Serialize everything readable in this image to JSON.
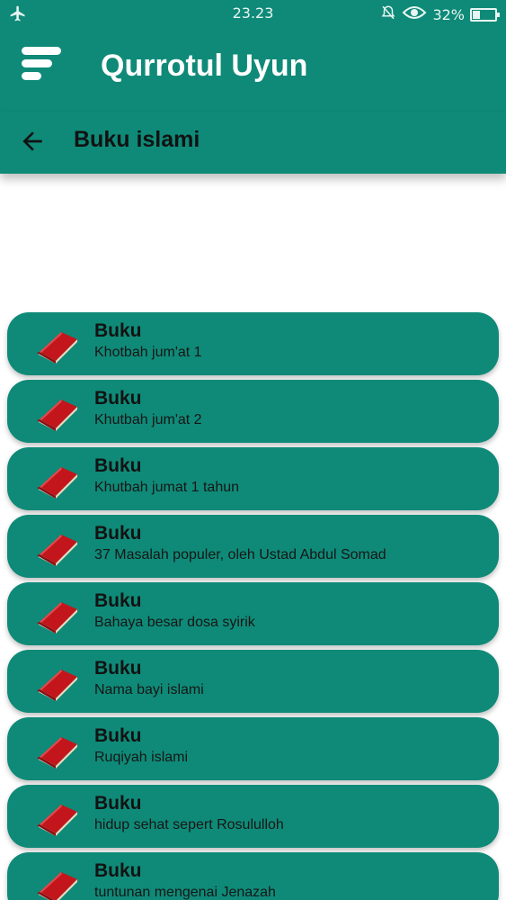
{
  "status_bar": {
    "time": "23.23",
    "battery_text": "32%",
    "battery_level": 0.32,
    "icons": [
      "airplane-icon",
      "alarm-off-icon",
      "eye-icon",
      "battery-icon"
    ]
  },
  "app_bar": {
    "title": "Qurrotul Uyun",
    "menu_icon": "menu-icon"
  },
  "sub_bar": {
    "title": "Buku islami",
    "back_icon": "back-arrow-icon"
  },
  "items": [
    {
      "title": "Buku",
      "subtitle": "Khotbah jum'at 1"
    },
    {
      "title": "Buku",
      "subtitle": "Khutbah jum'at 2"
    },
    {
      "title": "Buku",
      "subtitle": "Khutbah jumat 1 tahun"
    },
    {
      "title": "Buku",
      "subtitle": "37 Masalah populer, oleh Ustad Abdul Somad"
    },
    {
      "title": "Buku",
      "subtitle": "Bahaya besar dosa syirik"
    },
    {
      "title": "Buku",
      "subtitle": "Nama bayi islami"
    },
    {
      "title": "Buku",
      "subtitle": "Ruqiyah islami"
    },
    {
      "title": "Buku",
      "subtitle": "hidup sehat sepert Rosululloh"
    },
    {
      "title": "Buku",
      "subtitle": "tuntunan mengenai Jenazah"
    }
  ],
  "colors": {
    "primary": "#0f8a78",
    "book": "#c3161c",
    "text_dark": "#121212"
  }
}
